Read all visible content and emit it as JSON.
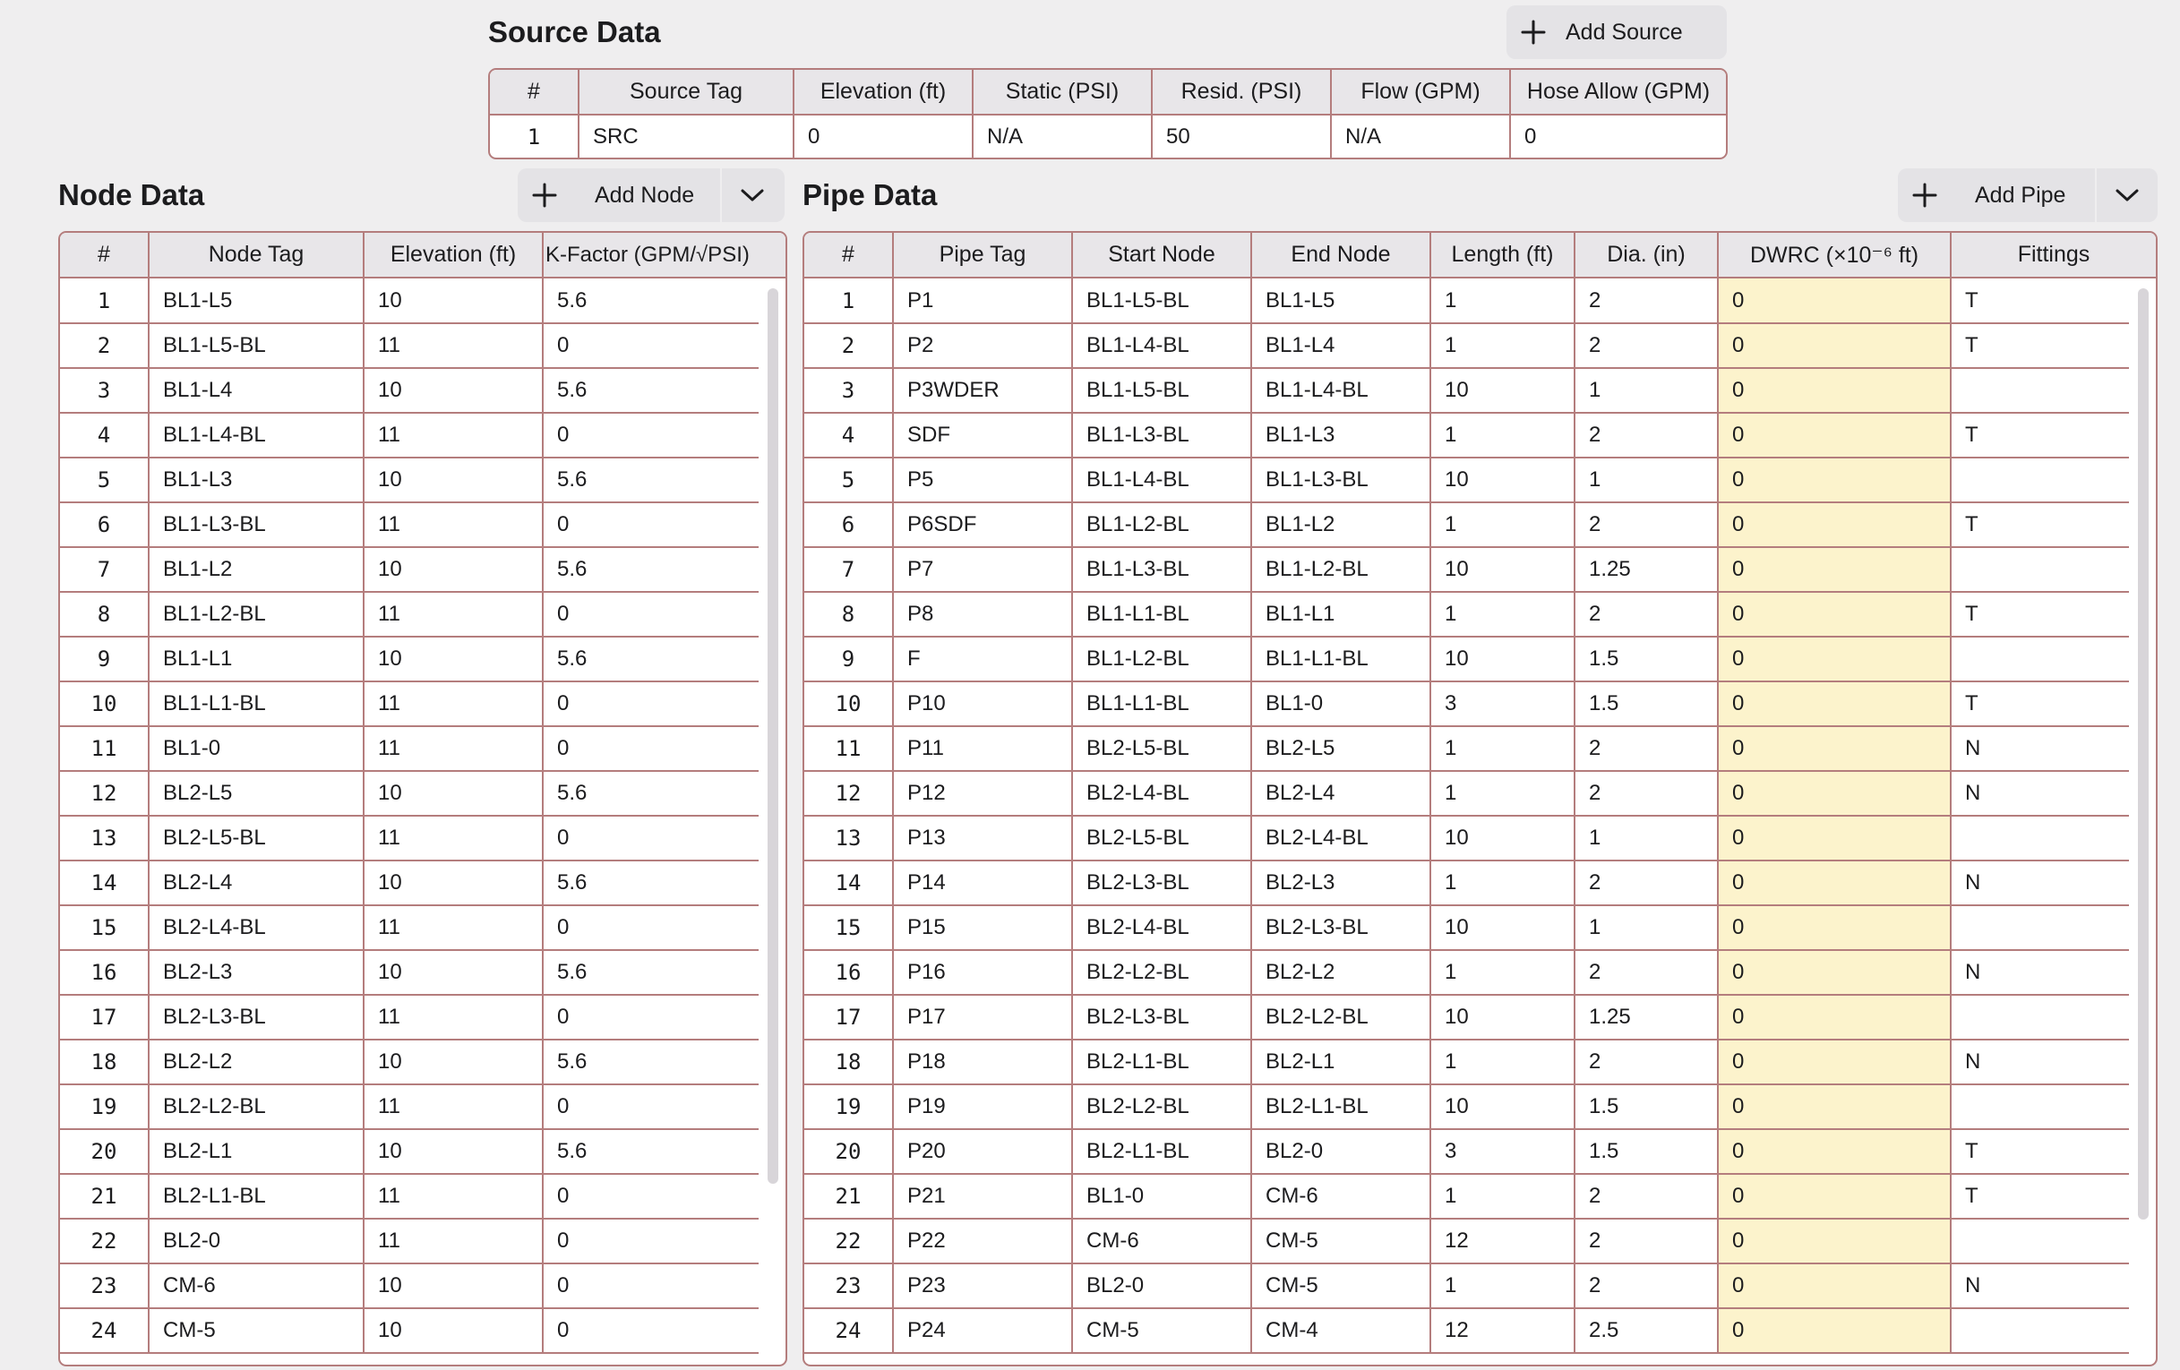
{
  "source": {
    "title": "Source Data",
    "add_label": "Add Source",
    "columns": [
      "#",
      "Source Tag",
      "Elevation (ft)",
      "Static (PSI)",
      "Resid. (PSI)",
      "Flow (GPM)",
      "Hose Allow (GPM)"
    ],
    "rows": [
      [
        "1",
        "SRC",
        "0",
        "N/A",
        "50",
        "N/A",
        "0"
      ]
    ]
  },
  "node": {
    "title": "Node Data",
    "add_label": "Add Node",
    "columns": [
      "#",
      "Node Tag",
      "Elevation (ft)",
      "K-Factor (GPM/√PSI)"
    ],
    "rows": [
      [
        "1",
        "BL1-L5",
        "10",
        "5.6"
      ],
      [
        "2",
        "BL1-L5-BL",
        "11",
        "0"
      ],
      [
        "3",
        "BL1-L4",
        "10",
        "5.6"
      ],
      [
        "4",
        "BL1-L4-BL",
        "11",
        "0"
      ],
      [
        "5",
        "BL1-L3",
        "10",
        "5.6"
      ],
      [
        "6",
        "BL1-L3-BL",
        "11",
        "0"
      ],
      [
        "7",
        "BL1-L2",
        "10",
        "5.6"
      ],
      [
        "8",
        "BL1-L2-BL",
        "11",
        "0"
      ],
      [
        "9",
        "BL1-L1",
        "10",
        "5.6"
      ],
      [
        "10",
        "BL1-L1-BL",
        "11",
        "0"
      ],
      [
        "11",
        "BL1-0",
        "11",
        "0"
      ],
      [
        "12",
        "BL2-L5",
        "10",
        "5.6"
      ],
      [
        "13",
        "BL2-L5-BL",
        "11",
        "0"
      ],
      [
        "14",
        "BL2-L4",
        "10",
        "5.6"
      ],
      [
        "15",
        "BL2-L4-BL",
        "11",
        "0"
      ],
      [
        "16",
        "BL2-L3",
        "10",
        "5.6"
      ],
      [
        "17",
        "BL2-L3-BL",
        "11",
        "0"
      ],
      [
        "18",
        "BL2-L2",
        "10",
        "5.6"
      ],
      [
        "19",
        "BL2-L2-BL",
        "11",
        "0"
      ],
      [
        "20",
        "BL2-L1",
        "10",
        "5.6"
      ],
      [
        "21",
        "BL2-L1-BL",
        "11",
        "0"
      ],
      [
        "22",
        "BL2-0",
        "11",
        "0"
      ],
      [
        "23",
        "CM-6",
        "10",
        "0"
      ],
      [
        "24",
        "CM-5",
        "10",
        "0"
      ]
    ]
  },
  "pipe": {
    "title": "Pipe Data",
    "add_label": "Add Pipe",
    "columns": [
      "#",
      "Pipe Tag",
      "Start Node",
      "End Node",
      "Length (ft)",
      "Dia. (in)",
      "DWRC (×10⁻⁶ ft)",
      "Fittings"
    ],
    "rows": [
      [
        "1",
        "P1",
        "BL1-L5-BL",
        "BL1-L5",
        "1",
        "2",
        "0",
        "T"
      ],
      [
        "2",
        "P2",
        "BL1-L4-BL",
        "BL1-L4",
        "1",
        "2",
        "0",
        "T"
      ],
      [
        "3",
        "P3WDER",
        "BL1-L5-BL",
        "BL1-L4-BL",
        "10",
        "1",
        "0",
        ""
      ],
      [
        "4",
        "SDF",
        "BL1-L3-BL",
        "BL1-L3",
        "1",
        "2",
        "0",
        "T"
      ],
      [
        "5",
        "P5",
        "BL1-L4-BL",
        "BL1-L3-BL",
        "10",
        "1",
        "0",
        ""
      ],
      [
        "6",
        "P6SDF",
        "BL1-L2-BL",
        "BL1-L2",
        "1",
        "2",
        "0",
        "T"
      ],
      [
        "7",
        "P7",
        "BL1-L3-BL",
        "BL1-L2-BL",
        "10",
        "1.25",
        "0",
        ""
      ],
      [
        "8",
        "P8",
        "BL1-L1-BL",
        "BL1-L1",
        "1",
        "2",
        "0",
        "T"
      ],
      [
        "9",
        "F",
        "BL1-L2-BL",
        "BL1-L1-BL",
        "10",
        "1.5",
        "0",
        ""
      ],
      [
        "10",
        "P10",
        "BL1-L1-BL",
        "BL1-0",
        "3",
        "1.5",
        "0",
        "T"
      ],
      [
        "11",
        "P11",
        "BL2-L5-BL",
        "BL2-L5",
        "1",
        "2",
        "0",
        "N"
      ],
      [
        "12",
        "P12",
        "BL2-L4-BL",
        "BL2-L4",
        "1",
        "2",
        "0",
        "N"
      ],
      [
        "13",
        "P13",
        "BL2-L5-BL",
        "BL2-L4-BL",
        "10",
        "1",
        "0",
        ""
      ],
      [
        "14",
        "P14",
        "BL2-L3-BL",
        "BL2-L3",
        "1",
        "2",
        "0",
        "N"
      ],
      [
        "15",
        "P15",
        "BL2-L4-BL",
        "BL2-L3-BL",
        "10",
        "1",
        "0",
        ""
      ],
      [
        "16",
        "P16",
        "BL2-L2-BL",
        "BL2-L2",
        "1",
        "2",
        "0",
        "N"
      ],
      [
        "17",
        "P17",
        "BL2-L3-BL",
        "BL2-L2-BL",
        "10",
        "1.25",
        "0",
        ""
      ],
      [
        "18",
        "P18",
        "BL2-L1-BL",
        "BL2-L1",
        "1",
        "2",
        "0",
        "N"
      ],
      [
        "19",
        "P19",
        "BL2-L2-BL",
        "BL2-L1-BL",
        "10",
        "1.5",
        "0",
        ""
      ],
      [
        "20",
        "P20",
        "BL2-L1-BL",
        "BL2-0",
        "3",
        "1.5",
        "0",
        "T"
      ],
      [
        "21",
        "P21",
        "BL1-0",
        "CM-6",
        "1",
        "2",
        "0",
        "T"
      ],
      [
        "22",
        "P22",
        "CM-6",
        "CM-5",
        "12",
        "2",
        "0",
        ""
      ],
      [
        "23",
        "P23",
        "BL2-0",
        "CM-5",
        "1",
        "2",
        "0",
        "N"
      ],
      [
        "24",
        "P24",
        "CM-5",
        "CM-4",
        "12",
        "2.5",
        "0",
        ""
      ]
    ]
  },
  "colors": {
    "border": "#b47d7d",
    "header_bg": "#e8e6e9",
    "highlight": "#fcf3cc",
    "background": "#efeeef"
  },
  "icons": [
    "plus-icon",
    "chevron-down-icon"
  ]
}
